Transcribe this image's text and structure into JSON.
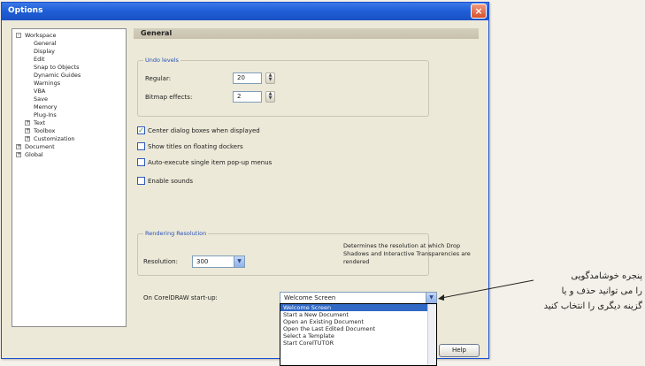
{
  "window": {
    "title": "Options",
    "close_glyph": "×"
  },
  "tree": {
    "items": [
      {
        "label": "Workspace",
        "expander": "-"
      },
      {
        "label": "General",
        "expander": ""
      },
      {
        "label": "Display",
        "expander": ""
      },
      {
        "label": "Edit",
        "expander": ""
      },
      {
        "label": "Snap to Objects",
        "expander": ""
      },
      {
        "label": "Dynamic Guides",
        "expander": ""
      },
      {
        "label": "Warnings",
        "expander": ""
      },
      {
        "label": "VBA",
        "expander": ""
      },
      {
        "label": "Save",
        "expander": ""
      },
      {
        "label": "Memory",
        "expander": ""
      },
      {
        "label": "Plug-Ins",
        "expander": ""
      },
      {
        "label": "Text",
        "expander": "+"
      },
      {
        "label": "Toolbox",
        "expander": "+"
      },
      {
        "label": "Customization",
        "expander": "+"
      },
      {
        "label": "Document",
        "expander": "+"
      },
      {
        "label": "Global",
        "expander": "+"
      }
    ]
  },
  "panel": {
    "header": "General",
    "undo_group_label": "Undo levels",
    "regular_label": "Regular:",
    "regular_value": "20",
    "bitmap_label": "Bitmap effects:",
    "bitmap_value": "2",
    "checkboxes": [
      {
        "label": "Center dialog boxes when displayed",
        "checked": true
      },
      {
        "label": "Show titles on floating dockers",
        "checked": false
      },
      {
        "label": "Auto-execute single item pop-up menus",
        "checked": false
      },
      {
        "label": "Enable sounds",
        "checked": false
      }
    ],
    "render_group_label": "Rendering Resolution",
    "resolution_label": "Resolution:",
    "resolution_value": "300",
    "render_desc": "Determines the resolution at which Drop Shadows and Interactive Transparencies are rendered",
    "startup_label": "On CorelDRAW start-up:",
    "startup_value": "Welcome Screen"
  },
  "dropdown": {
    "options": [
      {
        "label": "Welcome Screen",
        "selected": true
      },
      {
        "label": "Start a New Document",
        "selected": false
      },
      {
        "label": "Open an Existing Document",
        "selected": false
      },
      {
        "label": "Open the Last Edited Document",
        "selected": false
      },
      {
        "label": "Select a Template",
        "selected": false
      },
      {
        "label": "Start CorelTUTOR",
        "selected": false
      }
    ]
  },
  "buttons": {
    "help": "Help"
  },
  "annotation": {
    "lines": [
      "پنجره خوشامدگویی",
      "را می توانید حذف و یا",
      "گزینه دیگری را انتخاب کنید"
    ]
  },
  "colors": {
    "titlebar": "#1f5fd8",
    "selection": "#316ac5",
    "group_label": "#2752b4"
  }
}
